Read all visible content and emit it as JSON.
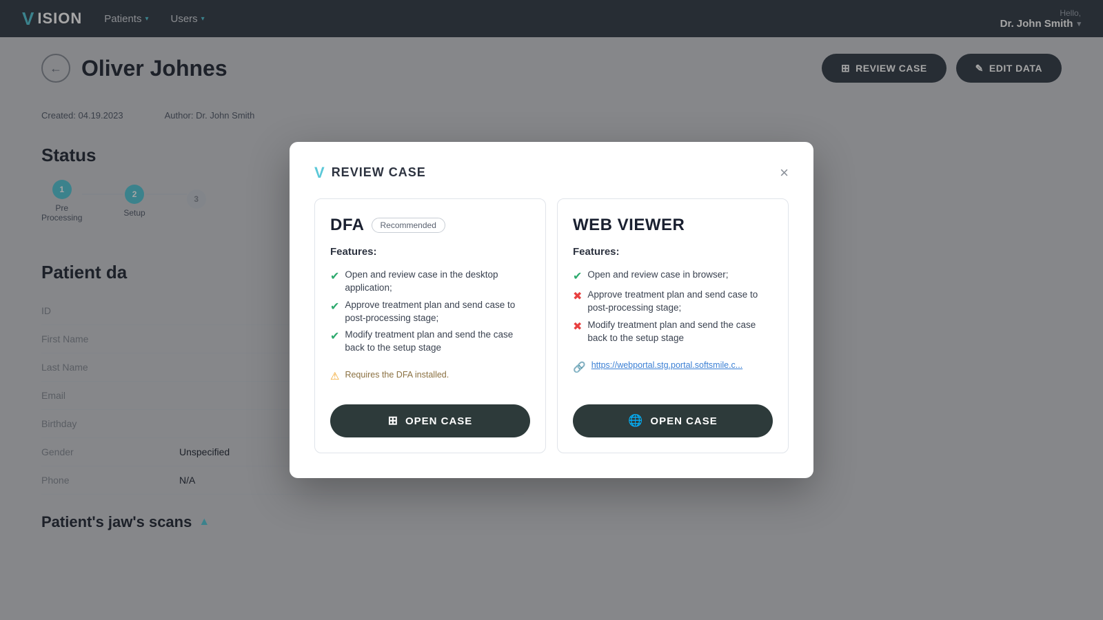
{
  "app": {
    "logo_text": "ISION",
    "logo_v": "V"
  },
  "navbar": {
    "patients_label": "Patients",
    "users_label": "Users",
    "hello_label": "Hello,",
    "doctor_name": "Dr. John Smith"
  },
  "page": {
    "back_label": "←",
    "patient_name": "Oliver Johnes",
    "review_case_btn": "REVIEW CASE",
    "edit_data_btn": "EDIT DATA",
    "created_label": "Created:",
    "created_date": "04.19.2023",
    "author_label": "Author:",
    "author_name": "Dr. John Smith",
    "status_title": "Status",
    "patient_data_title": "Patient da",
    "jaw_scans_title": "Patient's jaw's scans"
  },
  "steps": [
    {
      "num": "1",
      "label": "Pre\nProcessing"
    },
    {
      "num": "2",
      "label": "Setup"
    }
  ],
  "patient_fields": [
    {
      "label": "ID",
      "value": ""
    },
    {
      "label": "First Name",
      "value": ""
    },
    {
      "label": "Last Name",
      "value": ""
    },
    {
      "label": "Email",
      "value": ""
    },
    {
      "label": "Birthday",
      "value": ""
    },
    {
      "label": "Gender",
      "value": "Unspecified"
    },
    {
      "label": "Phone",
      "value": "N/A"
    }
  ],
  "modal": {
    "logo_v": "V",
    "title": "REVIEW CASE",
    "close_label": "×",
    "dfa": {
      "title": "DFA",
      "badge": "Recommended",
      "features_label": "Features:",
      "features": [
        {
          "text": "Open and review case in the desktop application;",
          "type": "check"
        },
        {
          "text": "Approve treatment plan and send case to post-processing stage;",
          "type": "check"
        },
        {
          "text": "Modify treatment plan and send the case back to the setup stage",
          "type": "check"
        }
      ],
      "warning": "Requires the DFA installed.",
      "open_case_btn": "OPEN CASE"
    },
    "web_viewer": {
      "title": "WEB VIEWER",
      "features_label": "Features:",
      "features": [
        {
          "text": "Open and review case in browser;",
          "type": "check"
        },
        {
          "text": "Approve treatment plan and send case to post-processing stage;",
          "type": "cross"
        },
        {
          "text": "Modify treatment plan and send the case back to the setup stage",
          "type": "cross"
        }
      ],
      "link_text": "https://webportal.stg.portal.softsmile.c...",
      "open_case_btn": "OPEN CASE"
    }
  }
}
